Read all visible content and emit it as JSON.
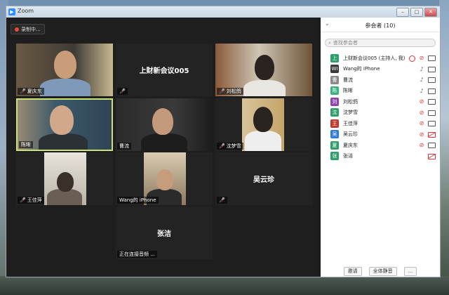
{
  "window": {
    "title": "Zoom",
    "app_icon": "zoom-app-icon",
    "buttons": {
      "minimize": "–",
      "maximize": "□",
      "close": "✕"
    }
  },
  "recording": {
    "label": "录制中..."
  },
  "tiles": [
    {
      "name": "夏庆东",
      "mic_muted": true,
      "show_video": true,
      "big_label": ""
    },
    {
      "name": "上财新会议005",
      "mic_muted": true,
      "show_video": false,
      "big_label": "上财新会议005"
    },
    {
      "name": "刘松鸽",
      "mic_muted": true,
      "show_video": true,
      "big_label": ""
    },
    {
      "name": "陈晰",
      "mic_muted": false,
      "show_video": true,
      "big_label": "",
      "active": true
    },
    {
      "name": "曹流",
      "mic_muted": false,
      "show_video": true,
      "big_label": ""
    },
    {
      "name": "沈梦雪",
      "mic_muted": true,
      "show_video": true,
      "big_label": ""
    },
    {
      "name": "王佳萍",
      "mic_muted": true,
      "show_video": true,
      "big_label": ""
    },
    {
      "name": "Wang的 iPhone",
      "mic_muted": false,
      "show_video": true,
      "big_label": ""
    },
    {
      "name": "",
      "mic_muted": true,
      "show_video": false,
      "big_label": "吴云珍"
    },
    {
      "name": "正在连接音频 ...",
      "mic_muted": false,
      "show_video": false,
      "big_label": "张洁"
    }
  ],
  "panel": {
    "title": "参会者 (10)",
    "search_placeholder": "查找参会者",
    "participants": [
      {
        "avatar": "上",
        "color": "#2e9e6a",
        "name": "上财新会议005 (主持人, 我)",
        "mic_muted": true,
        "cam_muted": false,
        "host": true
      },
      {
        "avatar": "WI",
        "color": "#3a3a3a",
        "name": "Wang的 iPhone",
        "mic_muted": false,
        "cam_muted": false
      },
      {
        "avatar": "曹",
        "color": "#8a8a8a",
        "name": "曹流",
        "mic_muted": false,
        "cam_muted": false
      },
      {
        "avatar": "陈",
        "color": "#36b37e",
        "name": "陈晰",
        "mic_muted": false,
        "cam_muted": false
      },
      {
        "avatar": "刘",
        "color": "#8e44ad",
        "name": "刘松鸽",
        "mic_muted": true,
        "cam_muted": false
      },
      {
        "avatar": "沈",
        "color": "#2e9e6a",
        "name": "沈梦雪",
        "mic_muted": true,
        "cam_muted": false
      },
      {
        "avatar": "王",
        "color": "#c0392b",
        "name": "王佳萍",
        "mic_muted": true,
        "cam_muted": false
      },
      {
        "avatar": "吴",
        "color": "#2d7be0",
        "name": "吴云珍",
        "mic_muted": true,
        "cam_muted": true
      },
      {
        "avatar": "夏",
        "color": "#2e9e6a",
        "name": "夏庆东",
        "mic_muted": true,
        "cam_muted": false
      },
      {
        "avatar": "张",
        "color": "#2e9e6a",
        "name": "张洁",
        "mic_muted": null,
        "cam_muted": true
      }
    ],
    "footer": {
      "invite": "邀请",
      "mute_all": "全体静音",
      "more": "..."
    }
  }
}
